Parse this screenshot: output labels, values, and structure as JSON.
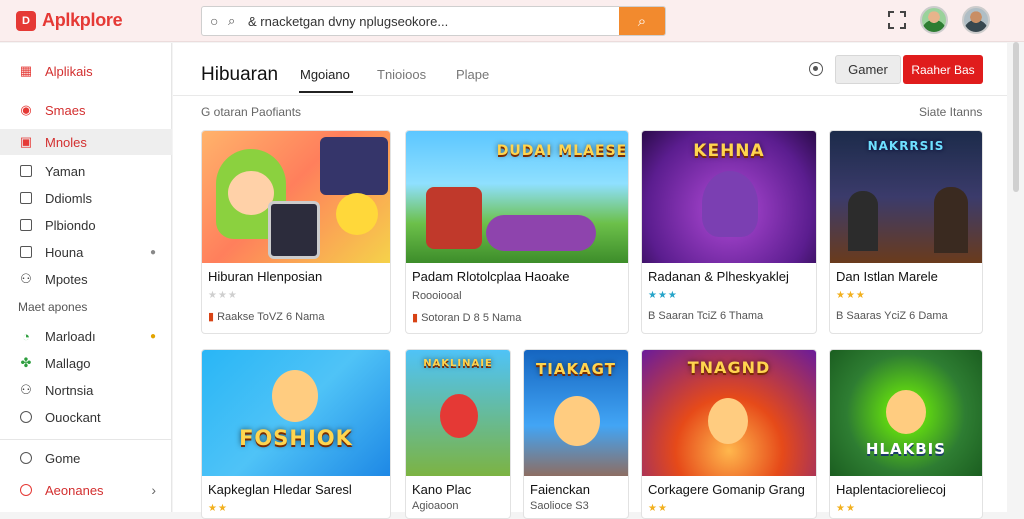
{
  "app": {
    "logo_mark": "D",
    "logo_text": "Aplkplore"
  },
  "search": {
    "value": "& rnacketgan dvny nplugseokore...",
    "placeholder": ""
  },
  "sidebar": {
    "items": [
      {
        "label": "Alplikais",
        "icon": "app-grid-icon"
      },
      {
        "label": "Smaes",
        "icon": "gamepad-icon"
      },
      {
        "label": "Mnoles",
        "icon": "film-icon"
      },
      {
        "label": "Yaman",
        "icon": "square-icon"
      },
      {
        "label": "Ddiomls",
        "icon": "square-icon"
      },
      {
        "label": "Plbiondo",
        "icon": "square-icon"
      },
      {
        "label": "Houna",
        "icon": "square-icon",
        "badge": "●"
      },
      {
        "label": "Mpotes",
        "icon": "people-icon"
      }
    ],
    "section_heading": "Maet apones",
    "section_items": [
      {
        "label": "Marloadı",
        "icon": "check-circle-icon",
        "badge": "●"
      },
      {
        "label": "Mallago",
        "icon": "puzzle-icon"
      },
      {
        "label": "Nortnsia",
        "icon": "people-icon"
      },
      {
        "label": "Ouockant",
        "icon": "circle-icon"
      }
    ],
    "bottom_items": [
      {
        "label": "Gome",
        "icon": "circle-icon"
      },
      {
        "label": "Aeonanes",
        "icon": "red-circle-icon",
        "chevron": "›"
      }
    ]
  },
  "main": {
    "title": "Hibuaran",
    "tabs": [
      "Mgoiano",
      "Tnioioos",
      "Plape"
    ],
    "active_tab": "Mgoiano",
    "btn_secondary": "Gamer",
    "btn_primary": "Raaher Bas",
    "section_left": "G otaran Paofiants",
    "section_right": "Siate Itanns"
  },
  "cards": [
    {
      "title": "Hiburan Hlenposian",
      "stars": "★★★",
      "meta": "Raakse ToVZ 6 Nama",
      "thumb_text": ""
    },
    {
      "title": "Padam Rlotolcplaa Haoake",
      "stars": "",
      "meta": "Sotoran D 8 5 Nama",
      "sub": "Roooiooal",
      "thumb_text": "DUDAI MLAESE"
    },
    {
      "title": "Radanan & Plheskyaklej",
      "stars": "★★★",
      "meta": "B Saaran TciZ 6 Thama",
      "thumb_text": "KEHNA"
    },
    {
      "title": "Dan Istlan Marele",
      "stars": "★★★",
      "meta": "B Saaras YciZ 6 Dama",
      "thumb_text": "NAKRRSIS"
    },
    {
      "title": "Kapkeglan Hledar Saresl",
      "stars": "★★",
      "thumb_text": "FOSHIOK"
    },
    {
      "title": "Kano Plac",
      "sub": "Agioaoon",
      "thumb_text": "NAKLINAIE"
    },
    {
      "title": "Faienckan",
      "sub": "Saolioce S3",
      "thumb_text": "TIAKAGT"
    },
    {
      "title": "Corkagere Gomanip Grang",
      "stars": "★★",
      "thumb_text": "TNAGND"
    },
    {
      "title": "Haplentacioreliecoj",
      "stars": "★★",
      "thumb_text": "HLAKBIS"
    }
  ],
  "colors": {
    "accent": "#e53935",
    "search_button": "#f28a2e",
    "primary_button": "#e01c1c"
  }
}
